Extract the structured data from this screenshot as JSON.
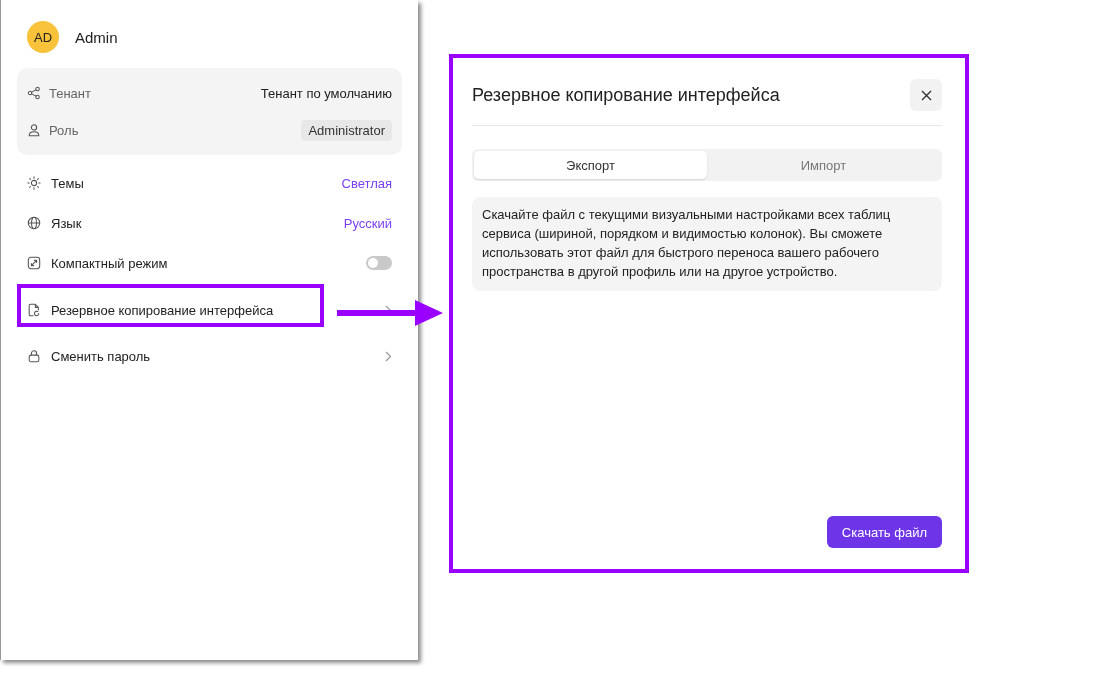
{
  "user": {
    "initials": "AD",
    "name": "Admin"
  },
  "info": [
    {
      "label": "Тенант",
      "value": "Тенант по умолчанию",
      "kind": "text"
    },
    {
      "label": "Роль",
      "value": "Administrator",
      "kind": "badge"
    }
  ],
  "menu": [
    {
      "label": "Темы",
      "kind": "value",
      "value": "Светлая",
      "highlighted": false
    },
    {
      "label": "Язык",
      "kind": "value",
      "value": "Русский",
      "highlighted": false
    },
    {
      "label": "Компактный режим",
      "kind": "toggle",
      "on": false,
      "highlighted": false
    },
    {
      "label": "Резервное копирование интерфейса",
      "kind": "link",
      "highlighted": true
    },
    {
      "label": "Сменить пароль",
      "kind": "link",
      "highlighted": false
    }
  ],
  "dialog": {
    "title": "Резервное копирование интерфейса",
    "tabs": [
      {
        "label": "Экспорт",
        "selected": true
      },
      {
        "label": "Импорт",
        "selected": false
      }
    ],
    "description": "Скачайте файл с текущими визуальными настройками всех таблиц сервиса (шириной, порядком и видимостью колонок). Вы сможете использовать этот файл для быстрого переноса вашего рабочего пространства в другой профиль или на другое устройство.",
    "button": "Скачать файл"
  }
}
